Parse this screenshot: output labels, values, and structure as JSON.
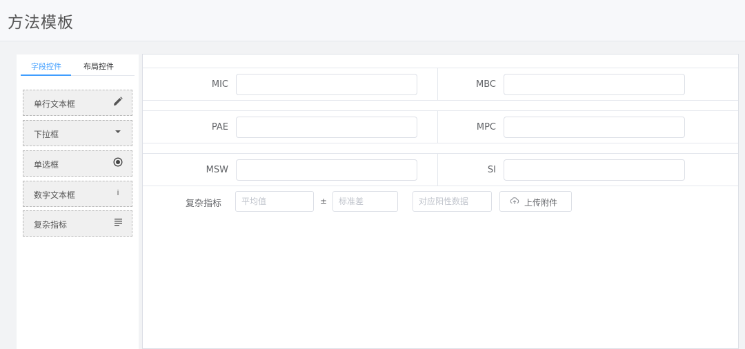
{
  "header": {
    "title": "方法模板"
  },
  "sidebar": {
    "tabs": [
      {
        "label": "字段控件",
        "active": true
      },
      {
        "label": "布局控件",
        "active": false
      }
    ],
    "widgets": [
      {
        "label": "单行文本框",
        "icon": "pencil-icon"
      },
      {
        "label": "下拉框",
        "icon": "caret-down-icon"
      },
      {
        "label": "单选框",
        "icon": "radio-icon"
      },
      {
        "label": "数字文本框",
        "icon": "info-icon"
      },
      {
        "label": "复杂指标",
        "icon": "text-align-icon"
      }
    ]
  },
  "form": {
    "rows": [
      {
        "left": {
          "label": "MIC",
          "value": ""
        },
        "right": {
          "label": "MBC",
          "value": ""
        }
      },
      {
        "left": {
          "label": "PAE",
          "value": ""
        },
        "right": {
          "label": "MPC",
          "value": ""
        }
      },
      {
        "left": {
          "label": "MSW",
          "value": ""
        },
        "right": {
          "label": "SI",
          "value": ""
        }
      }
    ],
    "complex": {
      "label": "复杂指标",
      "mean_placeholder": "平均值",
      "plusminus": "±",
      "std_placeholder": "标准差",
      "positive_placeholder": "对应阳性数据",
      "upload_label": "上传附件",
      "upload_icon": "cloud-upload-icon"
    }
  },
  "colors": {
    "accent": "#409eff",
    "border": "#dcdfe6"
  }
}
